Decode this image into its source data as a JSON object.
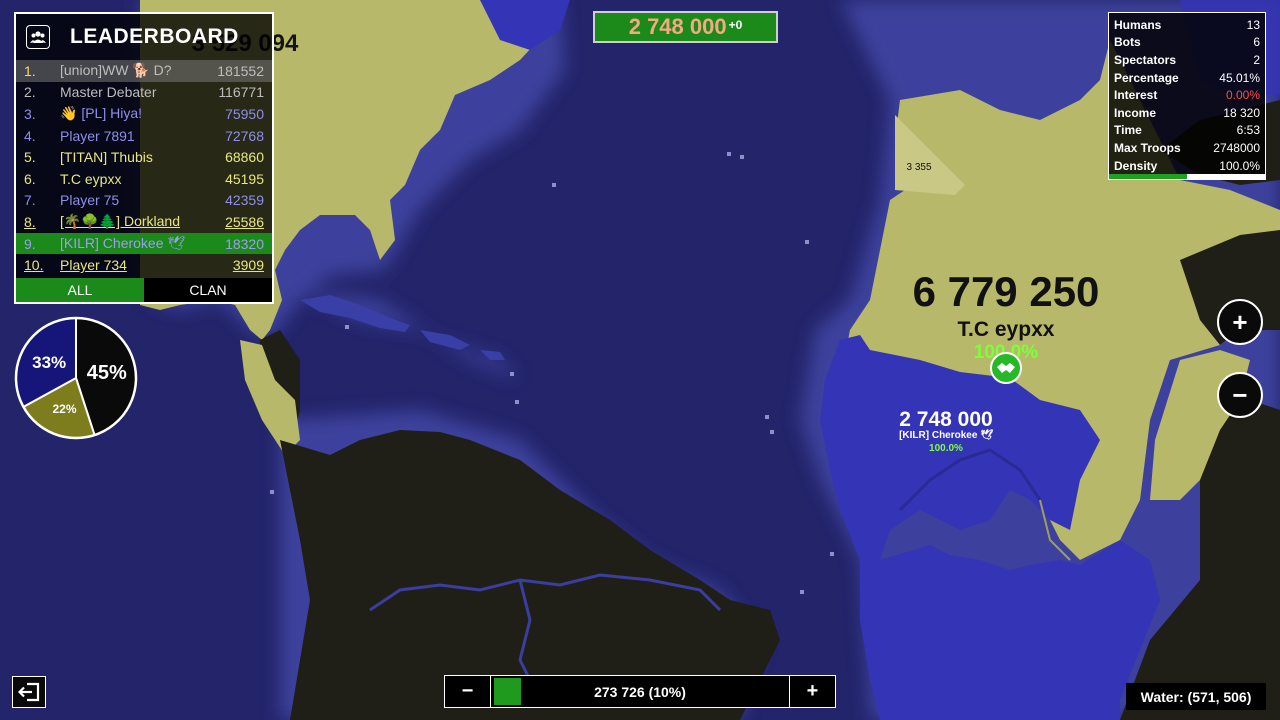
{
  "leaderboard": {
    "title": "LEADERBOARD",
    "rows": [
      {
        "rank": "1.",
        "name": "[union]WW 🐕 D?",
        "score": "181552",
        "color": "#bdbdbd"
      },
      {
        "rank": "2.",
        "name": "Master Debater",
        "score": "116771",
        "color": "#bdbdbd"
      },
      {
        "rank": "3.",
        "name": "👋 [PL] Hiya!",
        "score": "75950",
        "color": "#8e8eea"
      },
      {
        "rank": "4.",
        "name": "Player 7891",
        "score": "72768",
        "color": "#8e8eea"
      },
      {
        "rank": "5.",
        "name": "[TITAN] Thubis",
        "score": "68860",
        "color": "#e9e77a"
      },
      {
        "rank": "6.",
        "name": "T.C eypxx",
        "score": "45195",
        "color": "#e9e77a"
      },
      {
        "rank": "7.",
        "name": "Player 75",
        "score": "42359",
        "color": "#8e8eea"
      },
      {
        "rank": "8.",
        "name": "[🌴🌳🌲] Dorkland",
        "score": "25586",
        "color": "#e9e77a"
      },
      {
        "rank": "9.",
        "name": "[KILR] Cherokee 🕊",
        "score": "18320",
        "color": "#9d9df0"
      },
      {
        "rank": "10.",
        "name": "Player 734",
        "score": "3909",
        "color": "#e9e77a"
      }
    ],
    "tabs": {
      "all": "ALL",
      "clan": "CLAN"
    }
  },
  "pie": {
    "slices": [
      {
        "label": "45%",
        "value": 45,
        "color": "#0a0a0a"
      },
      {
        "label": "22%",
        "value": 22,
        "color": "#7d7d1e"
      },
      {
        "label": "33%",
        "value": 33,
        "color": "#16167a"
      }
    ]
  },
  "top_counter": {
    "value": "2 748 000",
    "delta": "+0"
  },
  "stats": {
    "rows": [
      {
        "label": "Humans",
        "value": "13",
        "color": "#ffffff"
      },
      {
        "label": "Bots",
        "value": "6",
        "color": "#ffffff"
      },
      {
        "label": "Spectators",
        "value": "2",
        "color": "#ffffff"
      },
      {
        "label": "Percentage",
        "value": "45.01%",
        "color": "#ffffff"
      },
      {
        "label": "Interest",
        "value": "0.00%",
        "color": "#ff4a4a"
      },
      {
        "label": "Income",
        "value": "18 320",
        "color": "#ffffff"
      },
      {
        "label": "Time",
        "value": "6:53",
        "color": "#ffffff"
      },
      {
        "label": "Max Troops",
        "value": "2748000",
        "color": "#ffffff"
      },
      {
        "label": "Density",
        "value": "100.0%",
        "color": "#ffffff"
      }
    ],
    "density_fraction": 0.5
  },
  "map": {
    "partial_top_label": "3 529 094",
    "small_label": "3 355",
    "player": {
      "troops": "6 779 250",
      "name": "T.C eypxx",
      "density": "100.0%"
    },
    "enemy": {
      "troops": "2 748 000",
      "name": "[KILR] Cherokee 🕊",
      "density": "100.0%"
    }
  },
  "zoom": {
    "in": "+",
    "out": "−"
  },
  "attack": {
    "minus": "−",
    "plus": "+",
    "text": "273 726 (10%)",
    "fraction": 0.1
  },
  "coords": "Water: (571, 506)",
  "colors": {
    "ocean": "#22235e",
    "land_olive": "#b8b86b",
    "land_dark": "#1f1e17",
    "land_blue": "#3434b6",
    "accent_green": "#1b8a1b"
  }
}
